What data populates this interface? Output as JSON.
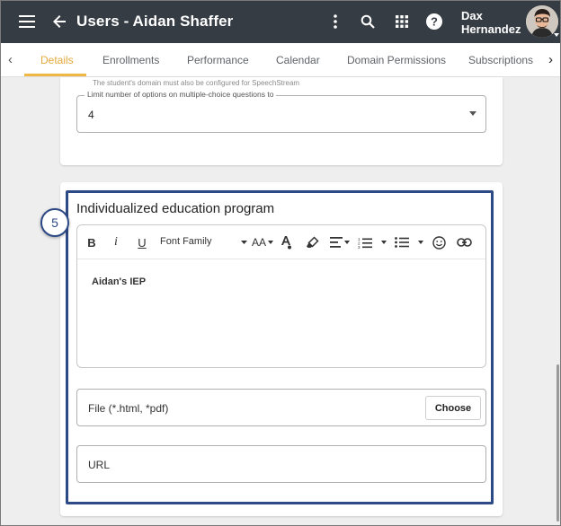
{
  "header": {
    "title": "Users - Aidan Shaffer",
    "user_first": "Dax",
    "user_last": "Hernandez",
    "icons": [
      "menu-icon",
      "back-arrow-icon",
      "more-vert-icon",
      "search-icon",
      "apps-grid-icon",
      "help-icon",
      "avatar",
      "caret-down-icon"
    ]
  },
  "tabs": [
    {
      "label": "Details",
      "active": true
    },
    {
      "label": "Enrollments",
      "active": false
    },
    {
      "label": "Performance",
      "active": false
    },
    {
      "label": "Calendar",
      "active": false
    },
    {
      "label": "Domain Permissions",
      "active": false
    },
    {
      "label": "Subscriptions",
      "active": false
    }
  ],
  "options_card": {
    "helper_text": "The student's domain must also be configured for SpeechStream",
    "limit_label": "Limit number of options on multiple-choice questions to",
    "limit_value": "4"
  },
  "iep_card": {
    "step_number": "5",
    "title": "Individualized education program",
    "toolbar": {
      "bold": "B",
      "italic": "i",
      "underline": "U",
      "font_family": "Font Family",
      "font_size": "AA"
    },
    "editor_content": "Aidan's IEP",
    "file_placeholder": "File (*.html, *pdf)",
    "choose_label": "Choose",
    "url_placeholder": "URL"
  },
  "colors": {
    "appbar": "#353c44",
    "tab_active": "#e3a93b",
    "highlight_border": "#2e4a86"
  }
}
